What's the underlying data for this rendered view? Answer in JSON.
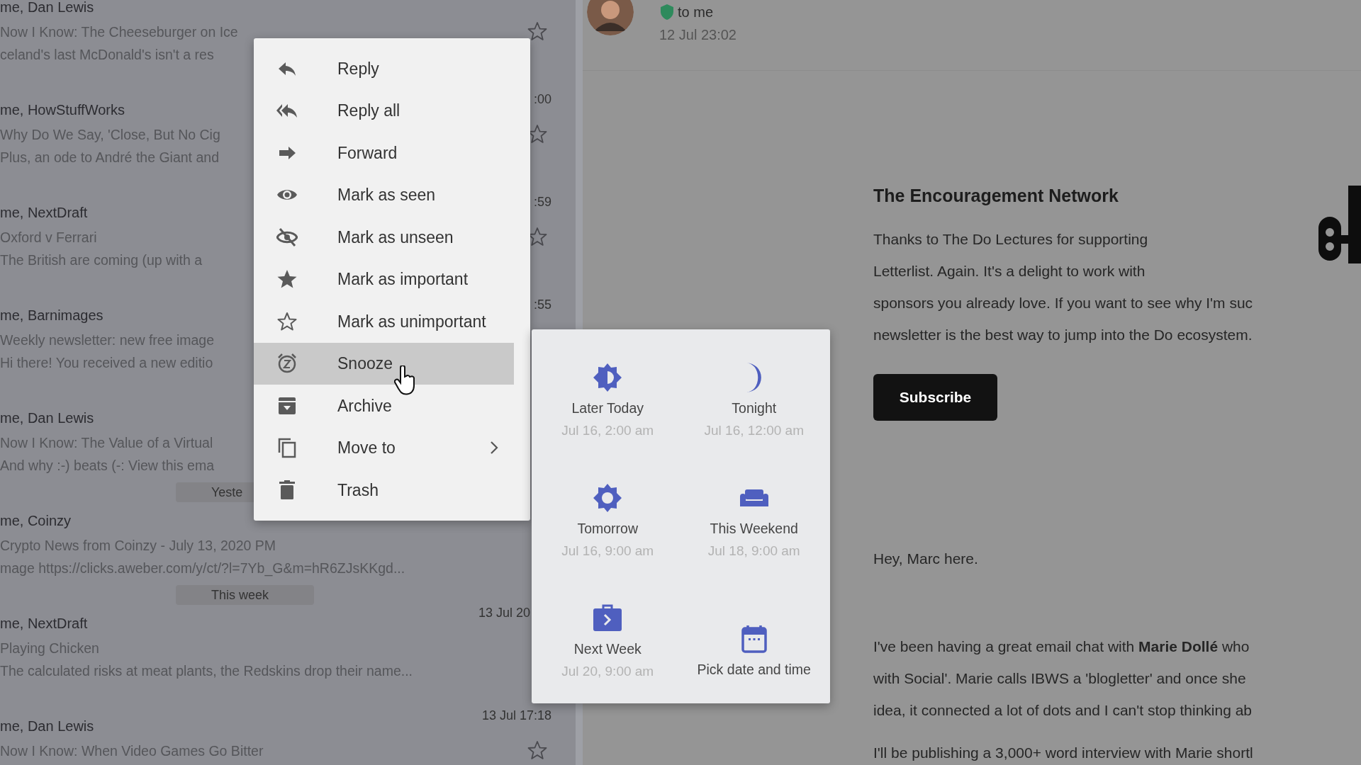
{
  "mail_list": {
    "items": [
      {
        "kind": "message",
        "sender": "me, Dan Lewis",
        "subject": "Now I Know: The Cheeseburger on Ice",
        "preview": "celand's last McDonald's isn't a res",
        "starred": false
      },
      {
        "kind": "message",
        "sender": "me, HowStuffWorks",
        "date": ":00",
        "subject": "Why Do We Say, 'Close, But No Cig",
        "preview": "Plus, an ode to André the Giant and",
        "starred": false
      },
      {
        "kind": "message",
        "sender": "me, NextDraft",
        "date": ":59",
        "subject": "Oxford v Ferrari",
        "preview": "The British are coming (up with a",
        "starred": false
      },
      {
        "kind": "message",
        "sender": "me, Barnimages",
        "date": ":55",
        "subject": "Weekly newsletter: new free image",
        "preview": "Hi there! You received a new editio"
      },
      {
        "kind": "message",
        "sender": "me, Dan Lewis",
        "subject": "Now I Know: The Value of a Virtual",
        "preview": "And why :-) beats (-:  View this ema"
      },
      {
        "kind": "separator",
        "label": "Yeste"
      },
      {
        "kind": "message",
        "sender": "me, Coinzy",
        "subject": "Crypto News from Coinzy - July 13, 2020 PM",
        "preview": "mage https://clicks.aweber.com/y/ct/?l=7Yb_G&m=hR6ZJsKKgd..."
      },
      {
        "kind": "separator",
        "label": "This week"
      },
      {
        "kind": "message",
        "sender": "me, NextDraft",
        "date": "13 Jul 20",
        "subject": "Playing Chicken",
        "preview": "The calculated risks at meat plants, the Redskins drop their name..."
      },
      {
        "kind": "message",
        "sender": "me, Dan Lewis",
        "date": "13 Jul 17:18",
        "subject": "Now I Know: When Video Games Go Bitter",
        "starred": false
      }
    ]
  },
  "context_menu": {
    "items": [
      {
        "label": "Reply",
        "selected": false,
        "submenu": false
      },
      {
        "label": "Reply all",
        "selected": false,
        "submenu": false
      },
      {
        "label": "Forward",
        "selected": false,
        "submenu": false
      },
      {
        "label": "Mark as seen",
        "selected": false,
        "submenu": false
      },
      {
        "label": "Mark as unseen",
        "selected": false,
        "submenu": false
      },
      {
        "label": "Mark as important",
        "selected": false,
        "submenu": false
      },
      {
        "label": "Mark as unimportant",
        "selected": false,
        "submenu": false
      },
      {
        "label": "Snooze",
        "selected": true,
        "submenu": false
      },
      {
        "label": "Archive",
        "selected": false,
        "submenu": false
      },
      {
        "label": "Move to",
        "selected": false,
        "submenu": true
      },
      {
        "label": "Trash",
        "selected": false,
        "submenu": false
      }
    ]
  },
  "snooze_panel": {
    "options": [
      {
        "label": "Later Today",
        "time": "Jul 16, 2:00 am"
      },
      {
        "label": "Tonight",
        "time": "Jul 16, 12:00 am"
      },
      {
        "label": "Tomorrow",
        "time": "Jul 16, 9:00 am"
      },
      {
        "label": "This Weekend",
        "time": "Jul 18, 9:00 am"
      },
      {
        "label": "Next Week",
        "time": "Jul 20, 9:00 am"
      },
      {
        "label": "Pick date and time"
      }
    ]
  },
  "message": {
    "recipient": "to me",
    "date": "12 Jul 23:02",
    "heading": "The Encouragement Network",
    "paragraphs": [
      [
        "Thanks to The Do Lectures for supporting",
        "Letterlist. Again. It's a delight to work with",
        "sponsors you already love. If you want to see why I'm suc",
        "newsletter is the best way to jump into the Do ecosystem."
      ]
    ],
    "button": "Subscribe",
    "greeting": "Hey, Marc here.",
    "body": [
      [
        "I've been having a great email chat with **Marie Dollé** who",
        "with Social'. Marie calls IBWS a 'blogletter' and once she",
        "idea, it connected a lot of dots and I can't stop thinking ab"
      ],
      [
        "I'll be publishing a 3,000+ word interview with Marie shortl"
      ]
    ]
  }
}
